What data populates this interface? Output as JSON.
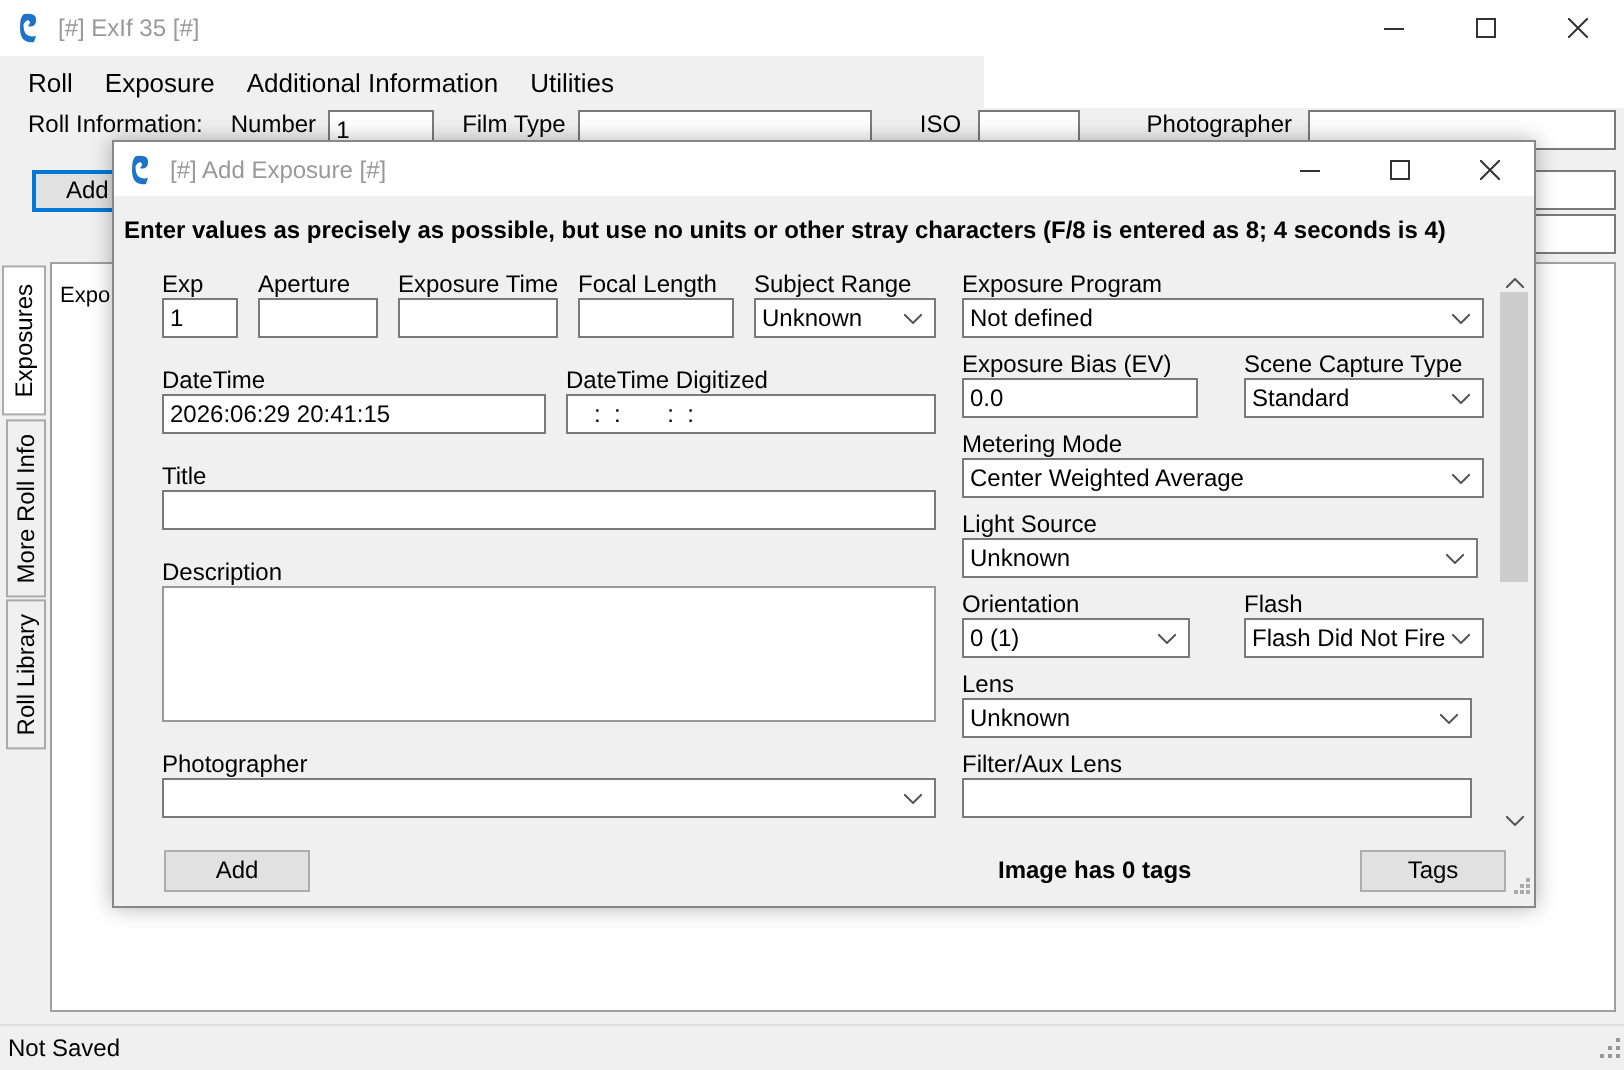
{
  "window": {
    "title": "[#] ExIf 35 [#]"
  },
  "menu": [
    "Roll",
    "Exposure",
    "Additional Information",
    "Utilities"
  ],
  "roll_information": {
    "label": "Roll Information:",
    "number_label": "Number",
    "number": "1",
    "film_type_label": "Film Type",
    "iso_label": "ISO",
    "photographer_label": "Photographer"
  },
  "add_button": "Add",
  "side_tabs": [
    {
      "label": "Exposures",
      "selected": true
    },
    {
      "label": "More Roll Info",
      "selected": false
    },
    {
      "label": "Roll Library",
      "selected": false
    }
  ],
  "tab_page": {
    "label": "Expo"
  },
  "dialog": {
    "title": "[#] Add Exposure [#]",
    "instruction": "Enter values as precisely as possible, but use no units or other stray characters (F/8 is entered as 8; 4 seconds is 4)",
    "left_rows": [
      [
        {
          "label": "Exp",
          "kind": "text",
          "value": "1"
        },
        {
          "label": "Aperture",
          "kind": "text"
        },
        {
          "label": "Exposure Time",
          "kind": "text"
        },
        {
          "label": "Focal Length",
          "kind": "text"
        },
        {
          "label": "Subject Range",
          "kind": "select",
          "value": "Unknown"
        }
      ],
      [
        {
          "label": "DateTime",
          "kind": "text",
          "value": "2026:06:29 20:41:15"
        },
        {
          "label": "DateTime Digitized",
          "kind": "text",
          "value": "   :  :       :  :"
        }
      ],
      [
        {
          "label": "Title",
          "kind": "text"
        }
      ],
      [
        {
          "label": "Description",
          "kind": "textarea"
        }
      ],
      [
        {
          "label": "Photographer",
          "kind": "select"
        }
      ]
    ],
    "right_rows": [
      [
        {
          "label": "Exposure Program",
          "kind": "select",
          "value": "Not defined"
        }
      ],
      [
        {
          "label": "Exposure Bias (EV)",
          "kind": "text",
          "value": "0.0"
        },
        {
          "label": "Scene Capture Type",
          "kind": "select",
          "value": "Standard"
        }
      ],
      [
        {
          "label": "Metering Mode",
          "kind": "select",
          "value": "Center Weighted Average"
        }
      ],
      [
        {
          "label": "Light Source",
          "kind": "select",
          "value": "Unknown"
        }
      ],
      [
        {
          "label": "Orientation",
          "kind": "select",
          "value": "0 (1)"
        },
        {
          "label": "Flash",
          "kind": "select",
          "value": "Flash Did Not Fire"
        }
      ],
      [
        {
          "label": "Lens",
          "kind": "select",
          "value": "Unknown"
        }
      ],
      [
        {
          "label": "Filter/Aux Lens",
          "kind": "text"
        }
      ]
    ],
    "add_button": "Add",
    "tag_count": "Image has 0 tags",
    "tags_button": "Tags"
  },
  "status_bar": "Not Saved"
}
